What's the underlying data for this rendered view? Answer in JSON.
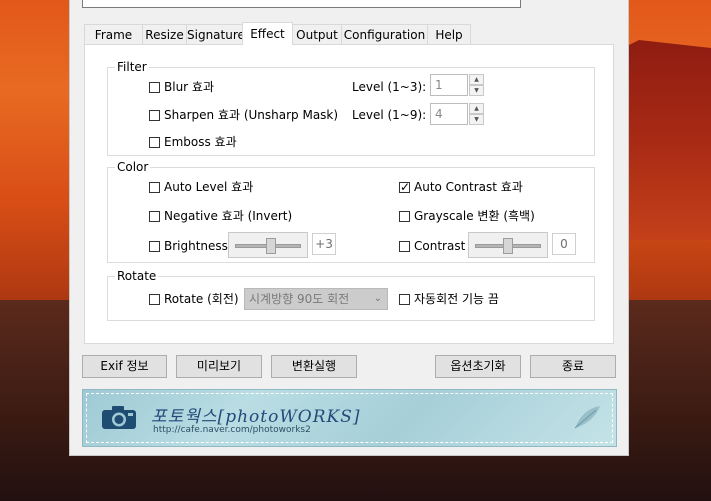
{
  "tabs": [
    {
      "label": "Frame"
    },
    {
      "label": "Resize"
    },
    {
      "label": "Signature"
    },
    {
      "label": "Effect",
      "active": true
    },
    {
      "label": "Output"
    },
    {
      "label": "Configuration"
    },
    {
      "label": "Help"
    }
  ],
  "filter": {
    "legend": "Filter",
    "blur": {
      "label": "Blur 효과",
      "checked": false
    },
    "sharpen": {
      "label": "Sharpen 효과 (Unsharp Mask)",
      "checked": false
    },
    "emboss": {
      "label": "Emboss 효과",
      "checked": false
    },
    "blur_level_label": "Level (1~3):",
    "blur_level_value": "1",
    "sharpen_level_label": "Level (1~9):",
    "sharpen_level_value": "4"
  },
  "color": {
    "legend": "Color",
    "auto_level": {
      "label": "Auto Level 효과",
      "checked": false
    },
    "auto_contrast": {
      "label": "Auto Contrast 효과",
      "checked": true
    },
    "negative": {
      "label": "Negative 효과 (Invert)",
      "checked": false
    },
    "grayscale": {
      "label": "Grayscale 변환 (흑백)",
      "checked": false
    },
    "brightness": {
      "label": "Brightness",
      "checked": false,
      "value": "+3",
      "slider_fraction": 0.55
    },
    "contrast": {
      "label": "Contrast",
      "checked": false,
      "value": "0",
      "slider_fraction": 0.5
    }
  },
  "rotate": {
    "legend": "Rotate",
    "rotate": {
      "label": "Rotate (회전)",
      "checked": false
    },
    "direction_selected": "시계방향 90도 회전",
    "auto_rotate_off": {
      "label": "자동회전 기능 끔",
      "checked": false
    }
  },
  "buttons": {
    "exif": "Exif 정보",
    "preview": "미리보기",
    "convert": "변환실행",
    "reset_options": "옵션초기화",
    "exit": "종료"
  },
  "banner": {
    "title": "포토웍스[photoWORKS]",
    "url": "http://cafe.naver.com/photoworks2"
  },
  "icons": {
    "camera": "camera-icon",
    "feather": "feather-icon",
    "check": "✓",
    "spin_up": "▲",
    "spin_down": "▼",
    "chevron": "⌄"
  }
}
